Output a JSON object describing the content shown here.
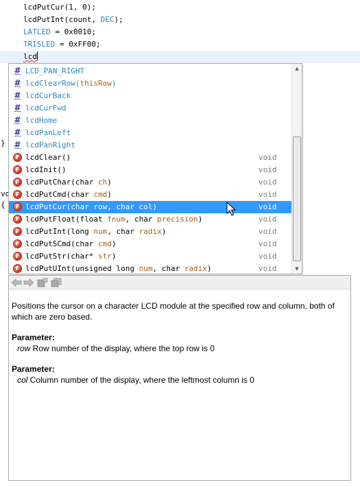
{
  "editor": {
    "lines": [
      {
        "text": "lcdPutCur(1, 0);"
      },
      {
        "text": "lcdPutInt(count, ",
        "const": "DEC",
        "tail": ");"
      },
      {
        "const": "LATLED",
        "tail": " = 0x0010;"
      },
      {
        "const": "TRISLED",
        "tail": " = 0xFF00;"
      }
    ],
    "current_line": "lcd",
    "gutter_fragments": [
      "}",
      "vo",
      "{"
    ]
  },
  "completion": {
    "items": [
      {
        "kind": "macro",
        "icon": "hash-icon",
        "name": "LCD_PAN_RIGHT",
        "params": "",
        "ret": ""
      },
      {
        "kind": "macro",
        "icon": "hash-icon",
        "name": "lcdClearRow(",
        "params": "thisRow",
        "tail": ")",
        "ret": ""
      },
      {
        "kind": "macro",
        "icon": "hash-icon",
        "name": "lcdCurBack",
        "params": "",
        "ret": ""
      },
      {
        "kind": "macro",
        "icon": "hash-icon",
        "name": "lcdCurFwd",
        "params": "",
        "ret": ""
      },
      {
        "kind": "macro",
        "icon": "hash-icon",
        "name": "lcdHome",
        "params": "",
        "ret": ""
      },
      {
        "kind": "macro",
        "icon": "hash-icon",
        "name": "lcdPanLeft",
        "params": "",
        "ret": ""
      },
      {
        "kind": "macro",
        "icon": "hash-icon",
        "name": "lcdPanRight",
        "params": "",
        "ret": ""
      },
      {
        "kind": "func",
        "icon": "function-icon",
        "parts": [
          [
            "lcdClear()",
            0
          ]
        ],
        "ret": "void"
      },
      {
        "kind": "func",
        "icon": "function-icon",
        "parts": [
          [
            "lcdInit()",
            0
          ]
        ],
        "ret": "void"
      },
      {
        "kind": "func",
        "icon": "function-icon",
        "parts": [
          [
            "lcdPutChar(char ",
            0
          ],
          [
            "ch",
            1
          ],
          [
            ")",
            0
          ]
        ],
        "ret": "void"
      },
      {
        "kind": "func",
        "icon": "function-icon",
        "parts": [
          [
            "lcdPutCmd(char ",
            0
          ],
          [
            "cmd",
            1
          ],
          [
            ")",
            0
          ]
        ],
        "ret": "void"
      },
      {
        "kind": "func",
        "icon": "function-icon",
        "selected": true,
        "parts": [
          [
            "lcdPutCur(char ",
            0
          ],
          [
            "row",
            1
          ],
          [
            ", char ",
            0
          ],
          [
            "col",
            1
          ],
          [
            ")",
            0
          ]
        ],
        "ret": "void"
      },
      {
        "kind": "func",
        "icon": "function-icon",
        "parts": [
          [
            "lcdPutFloat(float ",
            0
          ],
          [
            "fnum",
            1
          ],
          [
            ", char ",
            0
          ],
          [
            "precision",
            1
          ],
          [
            ")",
            0
          ]
        ],
        "ret": "void"
      },
      {
        "kind": "func",
        "icon": "function-icon",
        "parts": [
          [
            "lcdPutInt(long ",
            0
          ],
          [
            "num",
            1
          ],
          [
            ", char ",
            0
          ],
          [
            "radix",
            1
          ],
          [
            ")",
            0
          ]
        ],
        "ret": "void"
      },
      {
        "kind": "func",
        "icon": "function-icon",
        "parts": [
          [
            "lcdPutSCmd(char ",
            0
          ],
          [
            "cmd",
            1
          ],
          [
            ")",
            0
          ]
        ],
        "ret": "void"
      },
      {
        "kind": "func",
        "icon": "function-icon",
        "parts": [
          [
            "lcdPutStr(char* ",
            0
          ],
          [
            "str",
            1
          ],
          [
            ")",
            0
          ]
        ],
        "ret": "void"
      },
      {
        "kind": "func",
        "icon": "function-icon",
        "parts": [
          [
            "lcdPutUInt(unsigned long ",
            0
          ],
          [
            "num",
            1
          ],
          [
            ", char ",
            0
          ],
          [
            "radix",
            1
          ],
          [
            ")",
            0
          ]
        ],
        "ret": "void"
      }
    ]
  },
  "docs": {
    "toolbar": [
      "back-arrow-icon",
      "forward-arrow-icon",
      "goto-declaration-icon",
      "copy-icon"
    ],
    "description": "Positions the cursor on a character LCD module at the specified row and column, both of which are zero based.",
    "params": [
      {
        "heading": "Parameter:",
        "name": "row",
        "text": " Row number of the display, where the top row is 0"
      },
      {
        "heading": "Parameter:",
        "name": "col",
        "text": " Column number of the display, where the leftmost column is 0"
      }
    ]
  },
  "colors": {
    "selection": "#3399ff",
    "macro": "#2f86b8",
    "param": "#a6611f",
    "return": "#7f7f7f"
  }
}
